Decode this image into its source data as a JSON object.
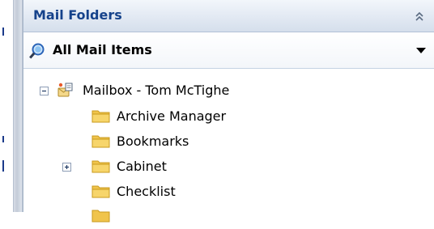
{
  "header": {
    "title": "Mail Folders"
  },
  "icons": {
    "collapse": "double-chevron-up-icon",
    "search": "search-folder-icon",
    "dropdown": "triangle-down-icon",
    "mailbox": "mailbox-icon",
    "folder": "folder-icon",
    "expanded": "minus-expander-icon",
    "collapsed": "plus-expander-icon"
  },
  "scope": {
    "label": "All Mail Items"
  },
  "tree": {
    "root": {
      "label": "Mailbox - Tom McTighe",
      "state": "expanded"
    },
    "folders": [
      {
        "label": "Archive Manager"
      },
      {
        "label": "Bookmarks"
      },
      {
        "label": "Cabinet",
        "state": "collapsed"
      },
      {
        "label": "Checklist"
      }
    ]
  },
  "colors": {
    "title": "#15428b",
    "folder": "#f0c44c",
    "folder_dark": "#c99a1e",
    "accent_left": "#1a3a8a"
  }
}
